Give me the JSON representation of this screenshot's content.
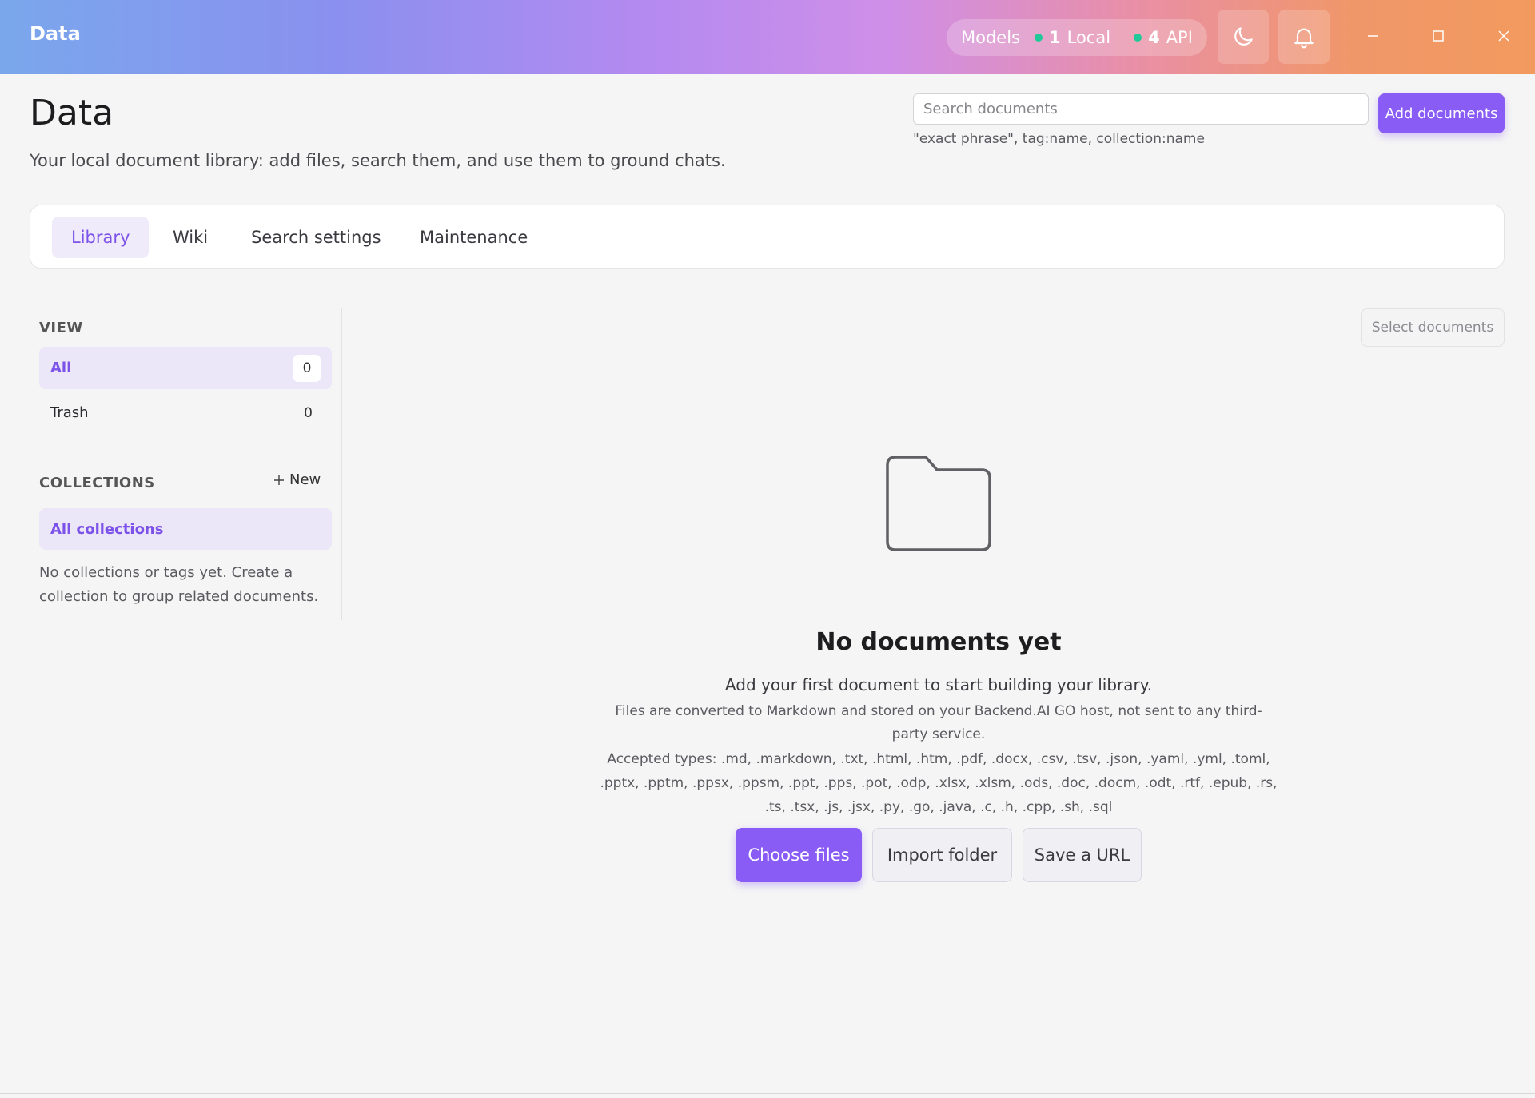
{
  "window": {
    "title": "Data",
    "models": {
      "label": "Models",
      "local_count": "1",
      "local_label": "Local",
      "api_count": "4",
      "api_label": "API",
      "status_color": "#20c997"
    },
    "theme_icon": "moon-icon",
    "notifications_icon": "bell-icon"
  },
  "header": {
    "title": "Data",
    "subtitle": "Your local document library: add files, search them, and use them to ground chats.",
    "search_placeholder": "Search documents",
    "search_hint": "\"exact phrase\", tag:name, collection:name",
    "add_button": "Add documents"
  },
  "tabs": [
    {
      "label": "Library",
      "active": true
    },
    {
      "label": "Wiki",
      "active": false
    },
    {
      "label": "Search settings",
      "active": false
    },
    {
      "label": "Maintenance",
      "active": false
    }
  ],
  "sidebar": {
    "view_label": "VIEW",
    "views": [
      {
        "label": "All",
        "count": "0"
      },
      {
        "label": "Trash",
        "count": "0"
      }
    ],
    "collections_label": "COLLECTIONS",
    "new_label": "New",
    "all_collections": "All collections",
    "empty_text": "No collections or tags yet. Create a collection to group related documents."
  },
  "main": {
    "select_button": "Select documents",
    "empty_icon": "folder-icon",
    "empty_title": "No documents yet",
    "empty_lead": "Add your first document to start building your library.",
    "empty_note": "Files are converted to Markdown and stored on your Backend.AI GO host, not sent to any third-party service.",
    "accepted_types": "Accepted types: .md, .markdown, .txt, .html, .htm, .pdf, .docx, .csv, .tsv, .json, .yaml, .yml, .toml, .pptx, .pptm, .ppsx, .ppsm, .ppt, .pps, .pot, .odp, .xlsx, .xlsm, .ods, .doc, .docm, .odt, .rtf, .epub, .rs, .ts, .tsx, .js, .jsx, .py, .go, .java, .c, .h, .cpp, .sh, .sql",
    "choose_files": "Choose files",
    "import_folder": "Import folder",
    "save_url": "Save a URL"
  },
  "colors": {
    "accent": "#8a5cf6",
    "accent_soft": "#ebe6f8",
    "background": "#f5f5f5"
  }
}
